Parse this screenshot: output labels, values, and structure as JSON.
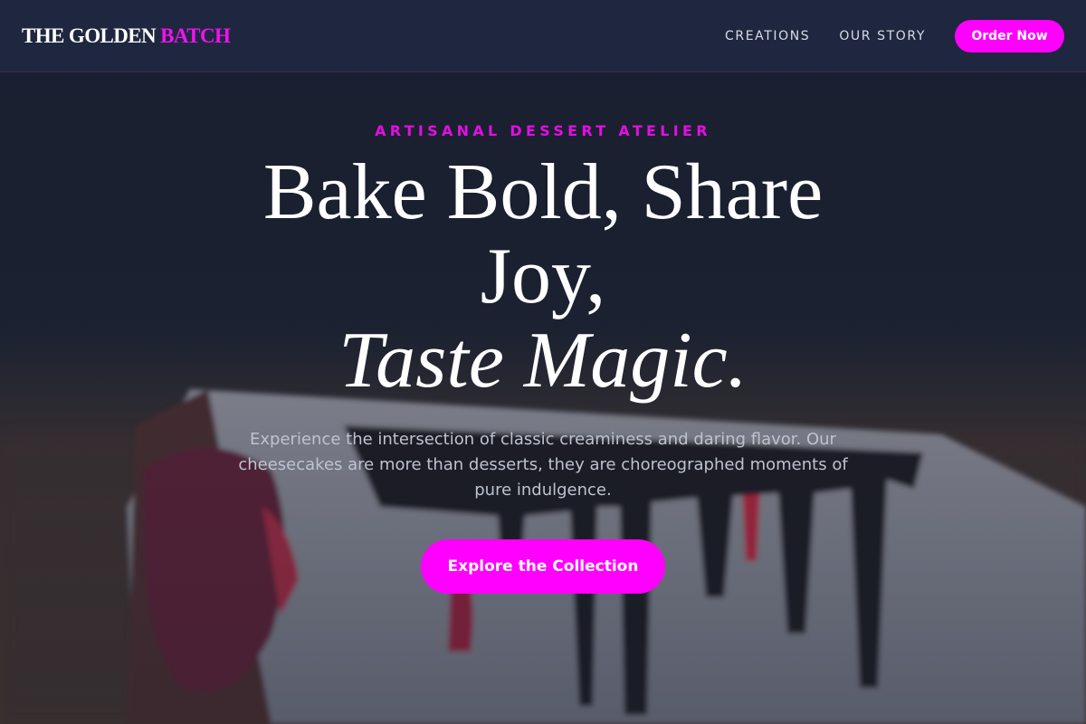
{
  "brand": {
    "name_part1": "THE GOLDEN",
    "name_part2": "BATCH"
  },
  "nav": {
    "links": [
      "CREATIONS",
      "OUR STORY"
    ],
    "order_button": "Order Now"
  },
  "hero": {
    "eyebrow": "ARTISANAL DESSERT ATELIER",
    "headline_line1": "Bake Bold, Share",
    "headline_line2": "Joy,",
    "headline_line3": "Taste Magic.",
    "subtext": "Experience the intersection of classic creaminess and daring flavor. Our cheesecakes are more than desserts, they are choreographed moments of pure indulgence.",
    "cta_button": "Explore the Collection",
    "background_image": "cheesecake-slice-with-berry-and-chocolate-drizzle"
  },
  "colors": {
    "accent": "#ff00ff",
    "navbar_bg": "#1f2740",
    "text_primary": "#ffffff",
    "text_muted": "#bdc3cf"
  }
}
